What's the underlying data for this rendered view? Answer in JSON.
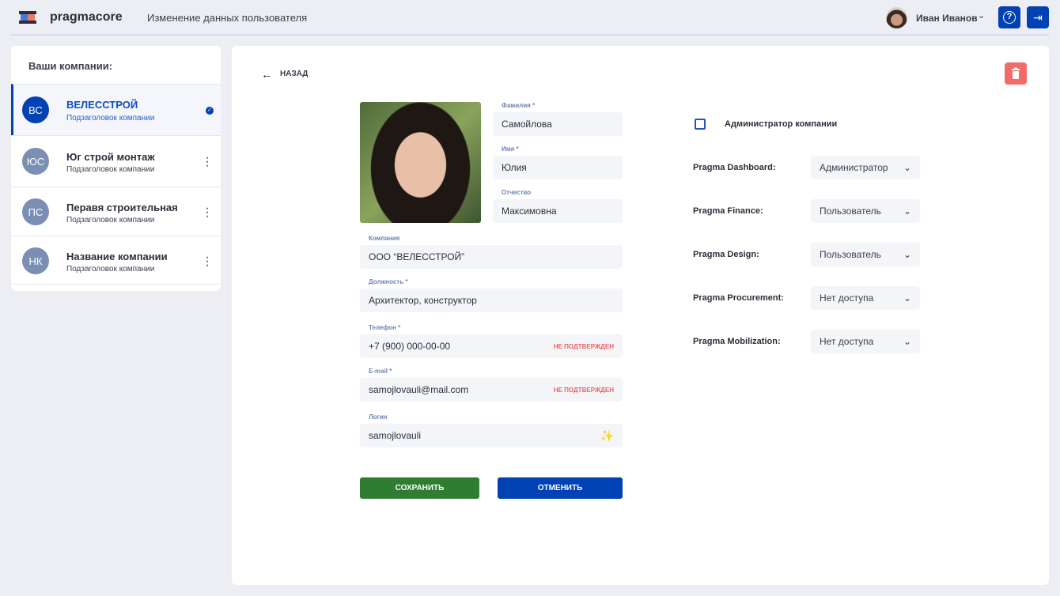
{
  "header": {
    "brand": "pragmacore",
    "title": "Изменение данных пользователя",
    "user_name": "Иван Иванов"
  },
  "sidebar": {
    "title": "Ваши компании:",
    "companies": [
      {
        "initials": "ВС",
        "name": "ВЕЛЕССТРОЙ",
        "subtitle": "Подзаголовок компании",
        "selected": true
      },
      {
        "initials": "ЮС",
        "name": "Юг строй монтаж",
        "subtitle": "Подзаголовок компании"
      },
      {
        "initials": "ПС",
        "name": "Перавя строительная",
        "subtitle": "Подзаголовок компании"
      },
      {
        "initials": "НК",
        "name": "Название компании",
        "subtitle": "Подзаголовок компании"
      }
    ]
  },
  "form": {
    "back_label": "НАЗАД",
    "last_name": {
      "label": "Фамилия *",
      "value": "Самойлова"
    },
    "first_name": {
      "label": "Имя *",
      "value": "Юлия"
    },
    "patronymic": {
      "label": "Отчество",
      "value": "Максимовна"
    },
    "company": {
      "label": "Компания",
      "value": "ООО “ВЕЛЕССТРОЙ”"
    },
    "position": {
      "label": "Должность *",
      "value": "Архитектор, конструктор"
    },
    "phone": {
      "label": "Телефон *",
      "value": "+7 (900) 000-00-00",
      "status": "НЕ ПОДТВЕРЖДЕН"
    },
    "email": {
      "label": "E-mail *",
      "value": "samojlovauli@mail.com",
      "status": "НЕ ПОДТВЕРЖДЕН"
    },
    "login": {
      "label": "Логин",
      "value": "samojlovauli"
    },
    "save_label": "СОХРАНИТЬ",
    "cancel_label": "ОТМЕНИТЬ"
  },
  "access": {
    "admin_label": "Администратор компании",
    "admin_checked": false,
    "modules": [
      {
        "label": "Pragma Dashboard:",
        "value": "Администратор"
      },
      {
        "label": "Pragma Finance:",
        "value": "Пользователь"
      },
      {
        "label": "Pragma Design:",
        "value": "Пользователь"
      },
      {
        "label": "Pragma Procurement:",
        "value": "Нет доступа"
      },
      {
        "label": "Pragma Mobilization:",
        "value": "Нет доступа"
      }
    ]
  },
  "colors": {
    "primary": "#0041b3",
    "save": "#2e7d32",
    "danger": "#f26b6b",
    "warning": "#f06060"
  }
}
